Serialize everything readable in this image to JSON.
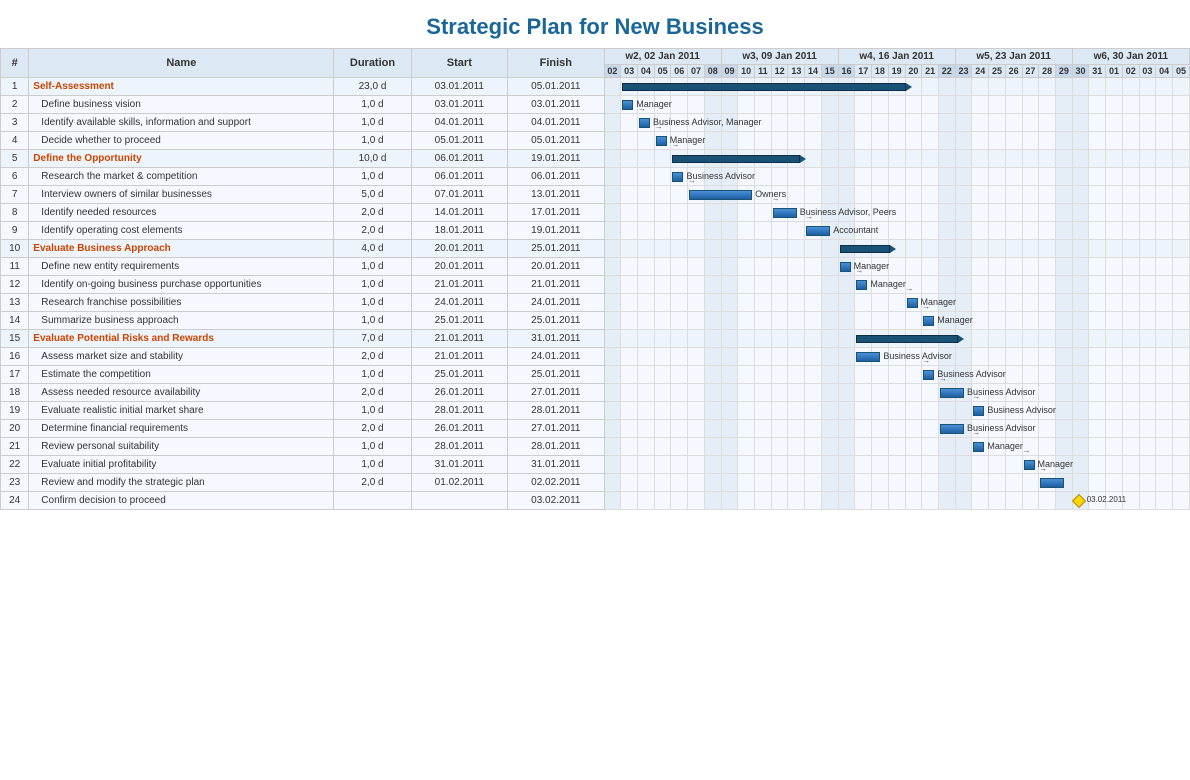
{
  "title": "Strategic Plan for New Business",
  "columns": {
    "num": "#",
    "name": "Name",
    "duration": "Duration",
    "start": "Start",
    "finish": "Finish"
  },
  "weeks": [
    {
      "label": "w2, 02 Jan 2011",
      "days": [
        "02",
        "03",
        "04",
        "05",
        "06",
        "07",
        "08"
      ]
    },
    {
      "label": "w3, 09 Jan 2011",
      "days": [
        "09",
        "10",
        "11",
        "12",
        "13",
        "14",
        "15"
      ]
    },
    {
      "label": "w4, 16 Jan 2011",
      "days": [
        "16",
        "17",
        "18",
        "19",
        "20",
        "21",
        "22"
      ]
    },
    {
      "label": "w5, 23 Jan 2011",
      "days": [
        "23",
        "24",
        "25",
        "26",
        "27",
        "28",
        "29"
      ]
    },
    {
      "label": "w6, 30 Jan 2011",
      "days": [
        "30",
        "31",
        "01",
        "02",
        "03",
        "04",
        "05"
      ]
    }
  ],
  "rows": [
    {
      "num": "1",
      "name": "Self-Assessment",
      "duration": "23,0 d",
      "start": "03.01.2011",
      "finish": "05.01.2011",
      "type": "group"
    },
    {
      "num": "2",
      "name": "Define business vision",
      "duration": "1,0 d",
      "start": "03.01.2011",
      "finish": "03.01.2011",
      "type": "task",
      "resource": "Manager",
      "barStart": 1,
      "barLen": 1
    },
    {
      "num": "3",
      "name": "Identify available skills, information and support",
      "duration": "1,0 d",
      "start": "04.01.2011",
      "finish": "04.01.2011",
      "type": "task",
      "resource": "Business Advisor, Manager",
      "barStart": 2,
      "barLen": 1
    },
    {
      "num": "4",
      "name": "Decide whether to proceed",
      "duration": "1,0 d",
      "start": "05.01.2011",
      "finish": "05.01.2011",
      "type": "task",
      "resource": "Manager",
      "barStart": 3,
      "barLen": 1
    },
    {
      "num": "5",
      "name": "Define the Opportunity",
      "duration": "10,0 d",
      "start": "06.01.2011",
      "finish": "19.01.2011",
      "type": "group"
    },
    {
      "num": "6",
      "name": "Research the market & competition",
      "duration": "1,0 d",
      "start": "06.01.2011",
      "finish": "06.01.2011",
      "type": "task",
      "resource": "Business Advisor",
      "barStart": 4,
      "barLen": 1
    },
    {
      "num": "7",
      "name": "Interview owners of similar businesses",
      "duration": "5,0 d",
      "start": "07.01.2011",
      "finish": "13.01.2011",
      "type": "task",
      "resource": "Owners",
      "barStart": 5,
      "barLen": 5
    },
    {
      "num": "8",
      "name": "Identify needed resources",
      "duration": "2,0 d",
      "start": "14.01.2011",
      "finish": "17.01.2011",
      "type": "task",
      "resource": "Business Advisor, Peers",
      "barStart": 10,
      "barLen": 2
    },
    {
      "num": "9",
      "name": "Identify operating cost elements",
      "duration": "2,0 d",
      "start": "18.01.2011",
      "finish": "19.01.2011",
      "type": "task",
      "resource": "Accountant",
      "barStart": 12,
      "barLen": 2
    },
    {
      "num": "10",
      "name": "Evaluate Business Approach",
      "duration": "4,0 d",
      "start": "20.01.2011",
      "finish": "25.01.2011",
      "type": "group"
    },
    {
      "num": "11",
      "name": "Define new entity requirements",
      "duration": "1,0 d",
      "start": "20.01.2011",
      "finish": "20.01.2011",
      "type": "task",
      "resource": "Manager",
      "barStart": 14,
      "barLen": 1
    },
    {
      "num": "12",
      "name": "Identify on-going business purchase opportunities",
      "duration": "1,0 d",
      "start": "21.01.2011",
      "finish": "21.01.2011",
      "type": "task",
      "resource": "Manager",
      "barStart": 15,
      "barLen": 1
    },
    {
      "num": "13",
      "name": "Research franchise possibilities",
      "duration": "1,0 d",
      "start": "24.01.2011",
      "finish": "24.01.2011",
      "type": "task",
      "resource": "Manager",
      "barStart": 18,
      "barLen": 1
    },
    {
      "num": "14",
      "name": "Summarize business approach",
      "duration": "1,0 d",
      "start": "25.01.2011",
      "finish": "25.01.2011",
      "type": "task",
      "resource": "Manager",
      "barStart": 19,
      "barLen": 1
    },
    {
      "num": "15",
      "name": "Evaluate Potential Risks and Rewards",
      "duration": "7,0 d",
      "start": "21.01.2011",
      "finish": "31.01.2011",
      "type": "group"
    },
    {
      "num": "16",
      "name": "Assess market size and stability",
      "duration": "2,0 d",
      "start": "21.01.2011",
      "finish": "24.01.2011",
      "type": "task",
      "resource": "Business Advisor",
      "barStart": 15,
      "barLen": 2
    },
    {
      "num": "17",
      "name": "Estimate the competition",
      "duration": "1,0 d",
      "start": "25.01.2011",
      "finish": "25.01.2011",
      "type": "task",
      "resource": "Business Advisor",
      "barStart": 19,
      "barLen": 1
    },
    {
      "num": "18",
      "name": "Assess needed resource availability",
      "duration": "2,0 d",
      "start": "26.01.2011",
      "finish": "27.01.2011",
      "type": "task",
      "resource": "Business Advisor",
      "barStart": 20,
      "barLen": 2
    },
    {
      "num": "19",
      "name": "Evaluate realistic initial market share",
      "duration": "1,0 d",
      "start": "28.01.2011",
      "finish": "28.01.2011",
      "type": "task",
      "resource": "Business Advisor",
      "barStart": 22,
      "barLen": 1
    },
    {
      "num": "20",
      "name": "Determine financial requirements",
      "duration": "2,0 d",
      "start": "26.01.2011",
      "finish": "27.01.2011",
      "type": "task",
      "resource": "Business Advisor",
      "barStart": 20,
      "barLen": 2
    },
    {
      "num": "21",
      "name": "Review personal suitability",
      "duration": "1,0 d",
      "start": "28.01.2011",
      "finish": "28.01.2011",
      "type": "task",
      "resource": "Manager",
      "barStart": 22,
      "barLen": 1
    },
    {
      "num": "22",
      "name": "Evaluate initial profitability",
      "duration": "1,0 d",
      "start": "31.01.2011",
      "finish": "31.01.2011",
      "type": "task",
      "resource": "Manager",
      "barStart": 25,
      "barLen": 1
    },
    {
      "num": "23",
      "name": "Review and modify the strategic plan",
      "duration": "2,0 d",
      "start": "01.02.2011",
      "finish": "02.02.2011",
      "type": "task",
      "resource": "",
      "barStart": 26,
      "barLen": 2
    },
    {
      "num": "24",
      "name": "Confirm decision to proceed",
      "duration": "",
      "start": "",
      "finish": "03.02.2011",
      "type": "milestone",
      "resource": "03.02.2011",
      "barStart": 28,
      "barLen": 0
    }
  ]
}
